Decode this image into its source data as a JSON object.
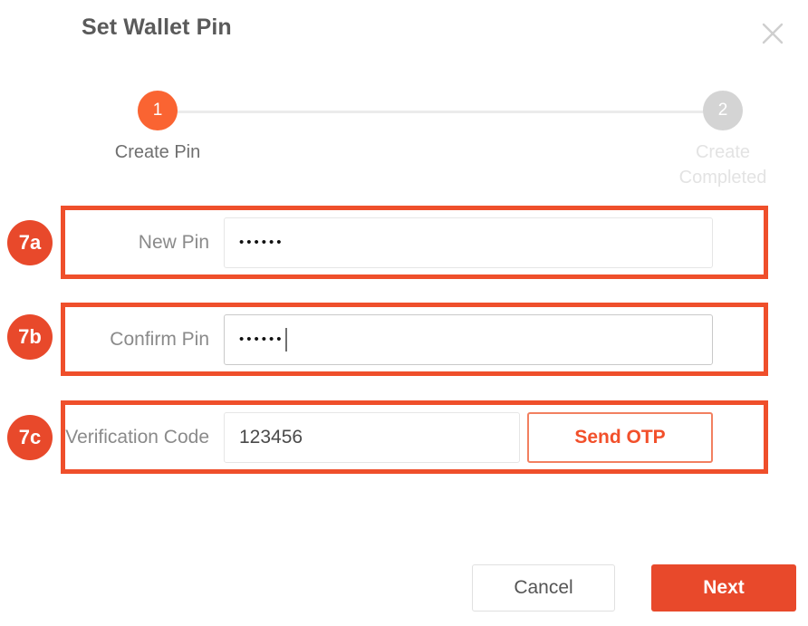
{
  "dialog": {
    "title": "Set Wallet Pin",
    "close_icon": "close-icon"
  },
  "stepper": {
    "steps": [
      {
        "number": "1",
        "label": "Create Pin",
        "state": "active"
      },
      {
        "number": "2",
        "label": "Create Completed",
        "state": "inactive"
      }
    ]
  },
  "form": {
    "rows": [
      {
        "badge": "7a",
        "label": "New Pin",
        "value": "••••••",
        "masked": true,
        "caret": false
      },
      {
        "badge": "7b",
        "label": "Confirm Pin",
        "value": "••••••",
        "masked": true,
        "caret": true
      },
      {
        "badge": "7c",
        "label": "Verification Code",
        "value": "123456",
        "masked": false,
        "caret": false,
        "action_label": "Send OTP"
      }
    ]
  },
  "footer": {
    "cancel_label": "Cancel",
    "next_label": "Next"
  },
  "colors": {
    "accent_step": "#fa6432",
    "accent_button": "#e8492b",
    "annotation": "#ef4f2b",
    "otp_border": "#f28060",
    "muted_text": "#8a8a8a",
    "inactive_step": "#d4d4d4"
  }
}
